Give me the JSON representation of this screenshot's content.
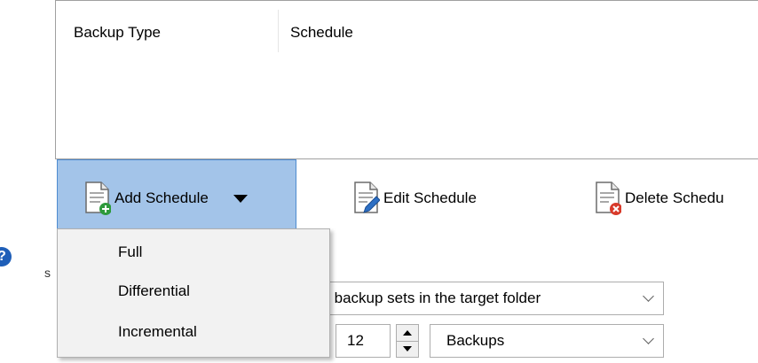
{
  "list": {
    "columns": [
      "Backup Type",
      "Schedule"
    ]
  },
  "toolbar": {
    "add_label": "Add Schedule",
    "edit_label": "Edit Schedule",
    "delete_label": "Delete Schedu"
  },
  "menu": {
    "items": [
      "Full",
      "Differential",
      "Incremental"
    ]
  },
  "retention": {
    "label_fragment": "s",
    "backup_sets_value": "ng backup sets in the target folder",
    "count_value": "12",
    "unit_value": "Backups"
  },
  "colors": {
    "selected_bg": "#a3c4e9",
    "selected_border": "#4e8bd0",
    "help_icon": "#1f5fb8",
    "add_badge": "#2e9a3c",
    "delete_badge": "#d83a2a",
    "edit_pen": "#2d6fc4"
  }
}
